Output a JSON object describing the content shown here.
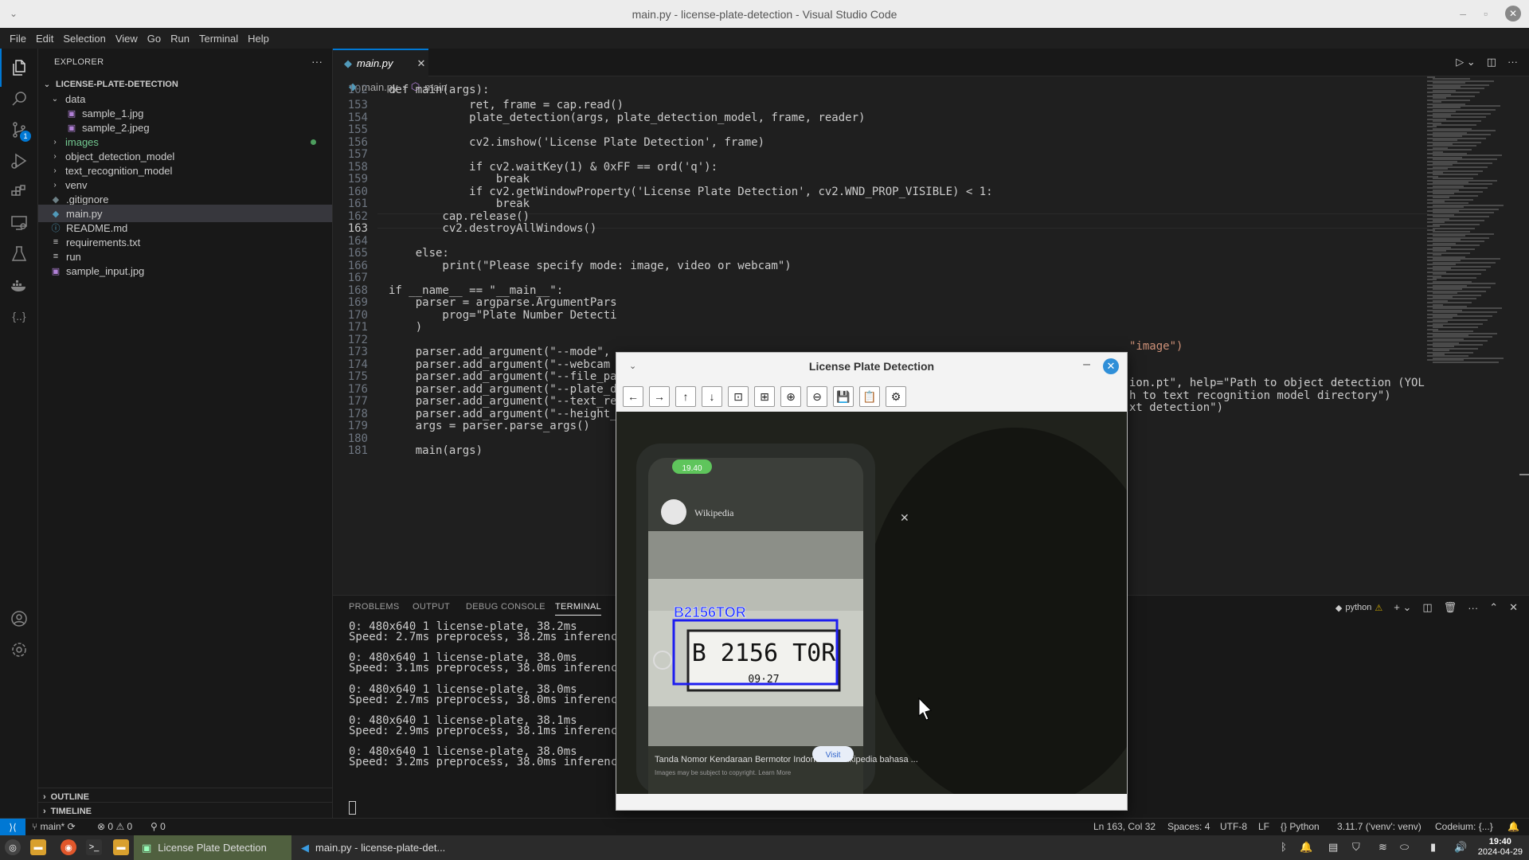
{
  "window": {
    "title": "main.py - license-plate-detection - Visual Studio Code"
  },
  "menu": [
    "File",
    "Edit",
    "Selection",
    "View",
    "Go",
    "Run",
    "Terminal",
    "Help"
  ],
  "activity": {
    "source_control_badge": "1"
  },
  "explorer": {
    "header": "EXPLORER",
    "more": "···",
    "project": "LICENSE-PLATE-DETECTION",
    "items": [
      {
        "label": "data",
        "type": "folder-open"
      },
      {
        "label": "sample_1.jpg",
        "type": "image"
      },
      {
        "label": "sample_2.jpeg",
        "type": "image"
      },
      {
        "label": "images",
        "type": "folder"
      },
      {
        "label": "object_detection_model",
        "type": "folder"
      },
      {
        "label": "text_recognition_model",
        "type": "folder"
      },
      {
        "label": "venv",
        "type": "folder"
      },
      {
        "label": ".gitignore",
        "type": "file"
      },
      {
        "label": "main.py",
        "type": "python"
      },
      {
        "label": "README.md",
        "type": "info"
      },
      {
        "label": "requirements.txt",
        "type": "text"
      },
      {
        "label": "run",
        "type": "text"
      },
      {
        "label": "sample_input.jpg",
        "type": "image"
      }
    ],
    "outline": "OUTLINE",
    "timeline": "TIMELINE"
  },
  "editor": {
    "tab": "main.py",
    "breadcrumb": [
      "main.py",
      "main"
    ],
    "lines": [
      {
        "n": "102",
        "text": "def main(args):"
      },
      {
        "n": "153",
        "text": "            ret, frame = cap.read()"
      },
      {
        "n": "154",
        "text": "            plate_detection(args, plate_detection_model, frame, reader)"
      },
      {
        "n": "155",
        "text": ""
      },
      {
        "n": "156",
        "text": "            cv2.imshow('License Plate Detection', frame)"
      },
      {
        "n": "157",
        "text": ""
      },
      {
        "n": "158",
        "text": "            if cv2.waitKey(1) & 0xFF == ord('q'):"
      },
      {
        "n": "159",
        "text": "                break"
      },
      {
        "n": "160",
        "text": "            if cv2.getWindowProperty('License Plate Detection', cv2.WND_PROP_VISIBLE) < 1:"
      },
      {
        "n": "161",
        "text": "                break"
      },
      {
        "n": "162",
        "text": "        cap.release()"
      },
      {
        "n": "163",
        "text": "        cv2.destroyAllWindows()"
      },
      {
        "n": "164",
        "text": ""
      },
      {
        "n": "165",
        "text": "    else:"
      },
      {
        "n": "166",
        "text": "        print(\"Please specify mode: image, video or webcam\")"
      },
      {
        "n": "167",
        "text": ""
      },
      {
        "n": "168",
        "text": "if __name__ == \"__main__\":"
      },
      {
        "n": "169",
        "text": "    parser = argparse.ArgumentPars"
      },
      {
        "n": "170",
        "text": "        prog=\"Plate Number Detecti"
      },
      {
        "n": "171",
        "text": "    )"
      },
      {
        "n": "172",
        "text": ""
      },
      {
        "n": "173",
        "text": "    parser.add_argument(\"--mode\","
      },
      {
        "n": "174",
        "text": "    parser.add_argument(\"--webcam"
      },
      {
        "n": "175",
        "text": "    parser.add_argument(\"--file_pa"
      },
      {
        "n": "176",
        "text": "    parser.add_argument(\"--plate_d"
      },
      {
        "n": "177",
        "text": "    parser.add_argument(\"--text_re"
      },
      {
        "n": "178",
        "text": "    parser.add_argument(\"--height_"
      },
      {
        "n": "179",
        "text": "    args = parser.parse_args()"
      },
      {
        "n": "180",
        "text": ""
      },
      {
        "n": "181",
        "text": "    main(args)"
      }
    ],
    "right_fragments": {
      "r173": "\"image\")",
      "r176": "ion.pt\", help=\"Path to object detection (YOL",
      "r177": "h to text recognition model directory\")",
      "r178": "xt detection\")"
    },
    "current_line": "163"
  },
  "panel": {
    "tabs": [
      "PROBLEMS",
      "OUTPUT",
      "DEBUG CONSOLE",
      "TERMINAL"
    ],
    "active_tab": "TERMINAL",
    "shell": "python",
    "terminal_lines": [
      "0: 480x640 1 license-plate, 38.2ms",
      "Speed: 2.7ms preprocess, 38.2ms inference,",
      "",
      "0: 480x640 1 license-plate, 38.0ms",
      "Speed: 3.1ms preprocess, 38.0ms inference,",
      "",
      "0: 480x640 1 license-plate, 38.0ms",
      "Speed: 2.7ms preprocess, 38.0ms inference,",
      "",
      "0: 480x640 1 license-plate, 38.1ms",
      "Speed: 2.9ms preprocess, 38.1ms inference,",
      "",
      "0: 480x640 1 license-plate, 38.0ms",
      "Speed: 3.2ms preprocess, 38.0ms inference,"
    ]
  },
  "statusbar": {
    "branch": "main*",
    "errors": "0",
    "warnings": "0",
    "ports": "0",
    "position": "Ln 163, Col 32",
    "spaces": "Spaces: 4",
    "encoding": "UTF-8",
    "eol": "LF",
    "language": "Python",
    "interpreter": "3.11.7 ('venv': venv)",
    "codeium": "Codeium: {...}"
  },
  "popup": {
    "title": "License Plate Detection",
    "detected_label": "B2156TOR",
    "plate_text": "B 2156 T0R",
    "plate_sub": "09·27",
    "phone_site": "Wikipedia",
    "phone_time": "19.40",
    "phone_caption": "Tanda Nomor Kendaraan Bermotor Indonesia - Wikipedia bahasa ...",
    "phone_caption2": "Images may be subject to copyright. Learn More",
    "phone_visit": "Visit"
  },
  "taskbar": {
    "apps": [
      "License Plate Detection",
      "main.py - license-plate-det..."
    ],
    "time": "19:40",
    "date": "2024-04-29",
    "accent": "#50603f"
  }
}
